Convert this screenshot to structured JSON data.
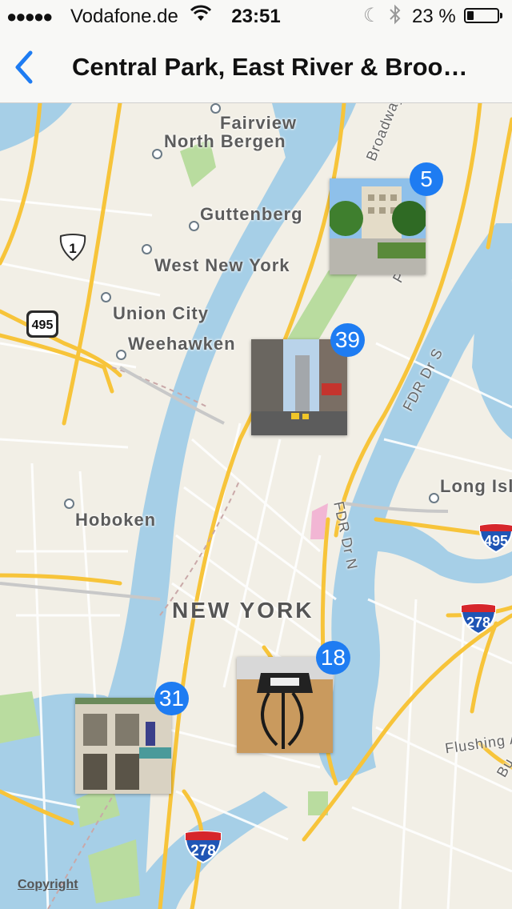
{
  "status_bar": {
    "signal": "●●●●●",
    "carrier": "Vodafone.de",
    "time": "23:51",
    "battery_percent": "23 %",
    "battery_level": 0.23
  },
  "nav": {
    "title": "Central Park, East River & Broo…"
  },
  "map": {
    "places": {
      "fairview": "Fairview",
      "north_bergen": "North Bergen",
      "guttenberg": "Guttenberg",
      "west_new_york": "West New York",
      "union_city": "Union City",
      "weehawken": "Weehawken",
      "hoboken": "Hoboken",
      "new_york": "NEW YORK",
      "long_island": "Long Isl",
      "flushing": "Flushing A",
      "bu": "Bu"
    },
    "roads": {
      "broadway": "Broadway",
      "fdr_drs": "FDR Dr S",
      "fdr_drn": "FDR Dr N",
      "park": "Pa"
    },
    "shields": {
      "us1": "1",
      "nj495": "495",
      "i495": "495",
      "i278_east": "278",
      "i278_south": "278"
    },
    "clusters": [
      {
        "count": "5"
      },
      {
        "count": "39"
      },
      {
        "count": "18"
      },
      {
        "count": "31"
      }
    ],
    "copyright": "Copyright"
  },
  "colors": {
    "water": "#a6cfe7",
    "land": "#f2efe6",
    "park": "#b9dc9f",
    "highway": "#f7c43a",
    "badge": "#1e7cf2",
    "accent": "#1e7cf2"
  }
}
